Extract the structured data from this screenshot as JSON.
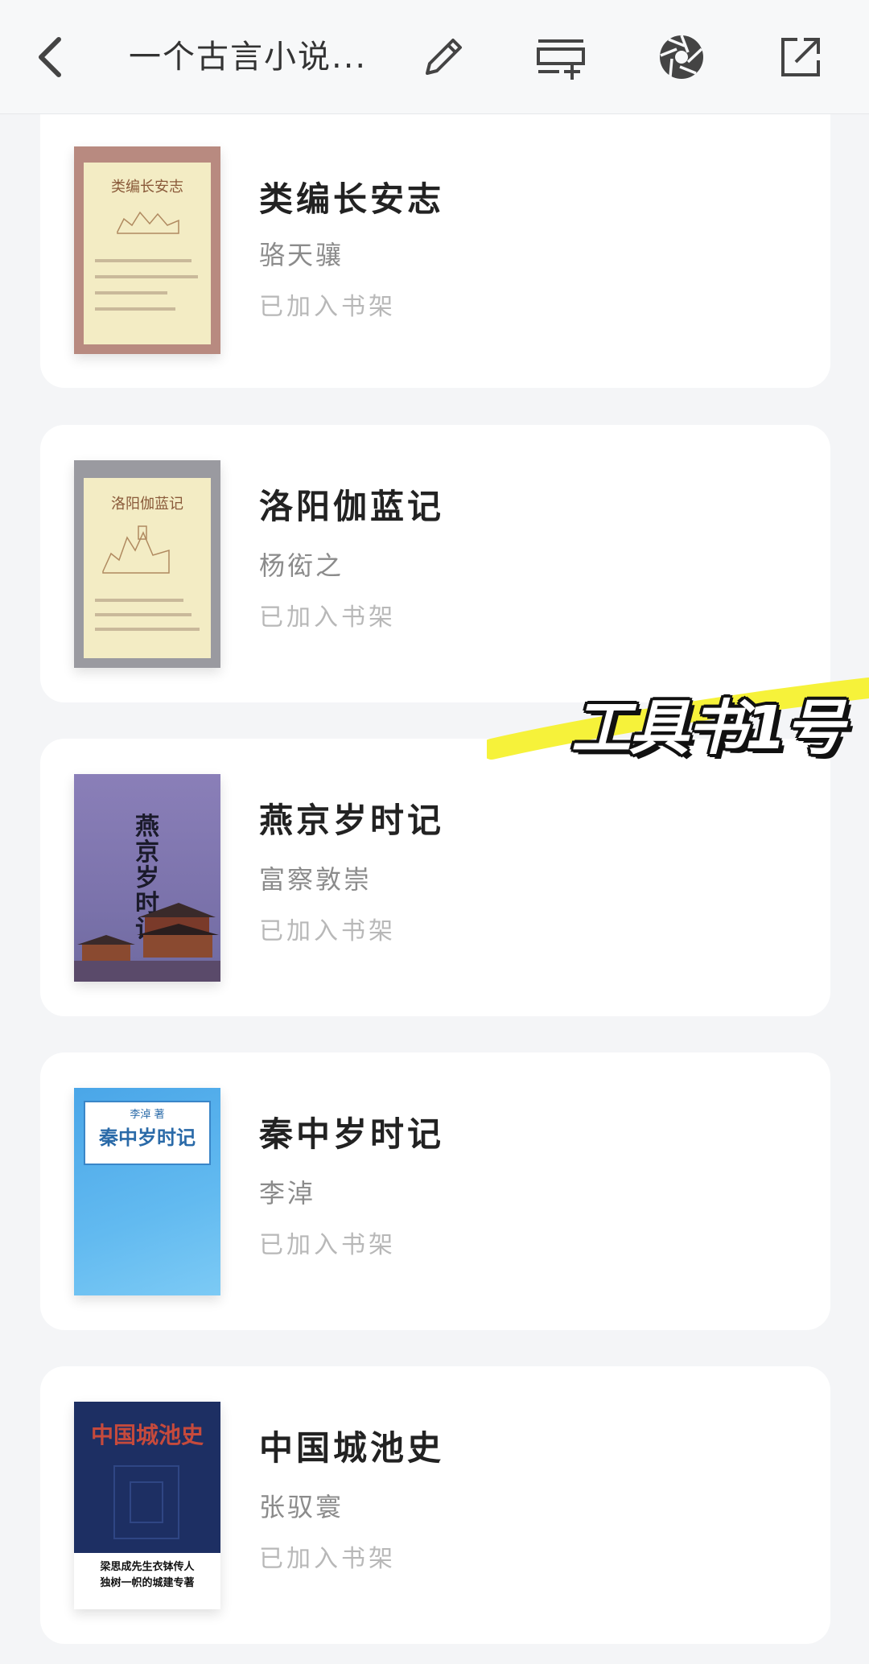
{
  "header": {
    "back_icon": "chevron-left-icon",
    "title": "一个古言小说...",
    "actions": [
      {
        "name": "edit-button",
        "icon": "pencil-icon"
      },
      {
        "name": "add-to-list-button",
        "icon": "list-add-icon"
      },
      {
        "name": "aperture-button",
        "icon": "aperture-icon"
      },
      {
        "name": "share-button",
        "icon": "external-link-icon"
      }
    ]
  },
  "books": [
    {
      "title": "类编长安志",
      "author": "骆天骧",
      "status": "已加入书架",
      "cover": {
        "title": "类编长安志",
        "colors": {
          "border": "#b88a80",
          "paper": "#f3ecc4"
        }
      }
    },
    {
      "title": "洛阳伽蓝记",
      "author": "杨衒之",
      "status": "已加入书架",
      "cover": {
        "title": "洛阳伽蓝记",
        "colors": {
          "border": "#9a9aa0",
          "paper": "#f3ecc4"
        }
      }
    },
    {
      "title": "燕京岁时记",
      "author": "富察敦崇",
      "status": "已加入书架",
      "cover": {
        "title": "燕京岁时记",
        "colors": {
          "bg": "#7d74ad"
        }
      }
    },
    {
      "title": "秦中岁时记",
      "author": "李淖",
      "status": "已加入书架",
      "cover": {
        "title": "秦中岁时记",
        "author": "李淖 著",
        "colors": {
          "bg": "#62baf0"
        }
      }
    },
    {
      "title": "中国城池史",
      "author": "张驭寰",
      "status": "已加入书架",
      "cover": {
        "title": "中国城池史",
        "tagline_1": "梁思成先生衣钵传人",
        "tagline_2": "独树一帜的城建专著",
        "colors": {
          "bg": "#1d2f63",
          "title": "#c64a3c"
        }
      }
    }
  ],
  "overlay": {
    "sticker_text": "工具书1号",
    "colors": {
      "highlight": "#f6f23a",
      "text": "#ffffff",
      "outline": "#111111"
    }
  }
}
